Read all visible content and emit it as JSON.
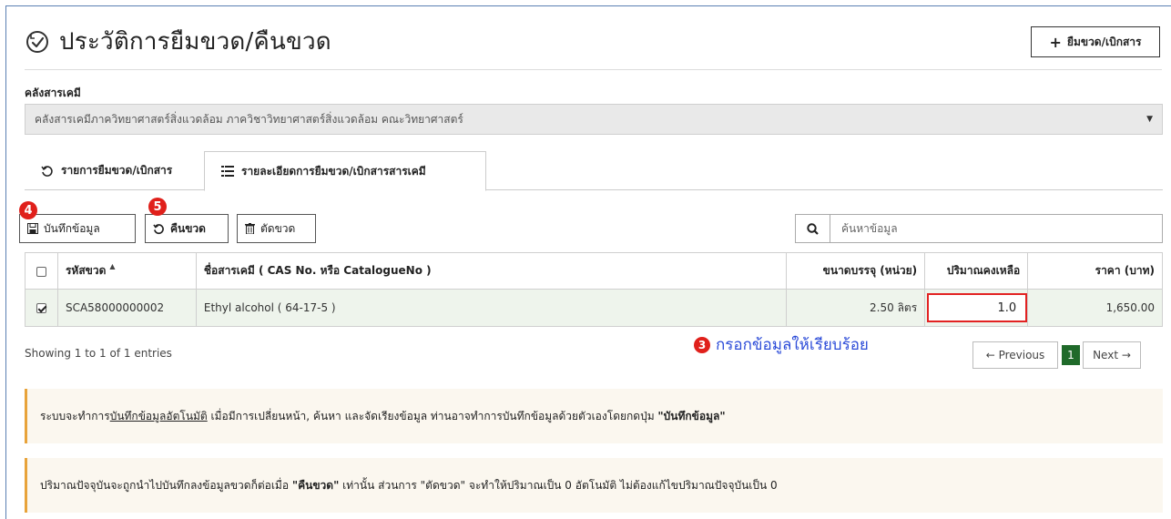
{
  "header": {
    "title": "ประวัติการยืมขวด/คืนขวด",
    "borrow_button": "ยืมขวด/เบิกสาร"
  },
  "store": {
    "label": "คลังสารเคมี",
    "selected": "คลังสารเคมีภาควิทยาศาสตร์สิ่งแวดล้อม ภาควิชาวิทยาศาสตร์สิ่งแวดล้อม คณะวิทยาศาสตร์"
  },
  "tabs": [
    {
      "label": "รายการยืมขวด/เบิกสาร"
    },
    {
      "label": "รายละเอียดการยืมขวด/เบิกสารสารเคมี"
    }
  ],
  "toolbar": {
    "save_label": "บันทึกข้อมูล",
    "return_label": "คืนขวด",
    "cut_label": "ตัดขวด",
    "save_badge": "4",
    "return_badge": "5"
  },
  "search": {
    "placeholder": "ค้นหาข้อมูล"
  },
  "table": {
    "headers": {
      "code": "รหัสขวด",
      "name": "ชื่อสารเคมี ( CAS No. หรือ CatalogueNo )",
      "size": "ขนาดบรรจุ (หน่วย)",
      "remaining": "ปริมาณคงเหลือ",
      "price": "ราคา (บาท)"
    },
    "rows": [
      {
        "checked": true,
        "code": "SCA58000000002",
        "name": "Ethyl alcohol ( 64-17-5 )",
        "size": "2.50 ลิตร",
        "remaining": "1.0",
        "price": "1,650.00"
      }
    ]
  },
  "info": "Showing 1 to 1 of 1 entries",
  "annotation": {
    "badge": "3",
    "text": "กรอกข้อมูลให้เรียบร้อย"
  },
  "pagination": {
    "previous": "← Previous",
    "current": "1",
    "next": "Next →"
  },
  "notices": {
    "n1_prefix": "ระบบจะทำการ",
    "n1_link": "บันทึกข้อมูลอัตโนมัติ",
    "n1_middle": " เมื่อมีการเปลี่ยนหน้า, ค้นหา และจัดเรียงข้อมูล ท่านอาจทำการบันทึกข้อมูลด้วยตัวเองโดยกดปุ่ม ",
    "n1_bold": "\"บันทึกข้อมูล\"",
    "n2_prefix": "ปริมาณปัจจุบันจะถูกนำไปบันทึกลงข้อมูลขวดก็ต่อเมื่อ ",
    "n2_bold": "\"คืนขวด\"",
    "n2_suffix": " เท่านั้น ส่วนการ \"ตัดขวด\" จะทำให้ปริมาณเป็น 0 อัตโนมัติ ไม่ต้องแก้ไขปริมาณปัจจุบันเป็น 0"
  },
  "colors": {
    "accent_green": "#1f6a2a",
    "highlight_red": "#e22222",
    "annotation_blue": "#2b4bd8",
    "notice_border": "#e8a33a"
  }
}
